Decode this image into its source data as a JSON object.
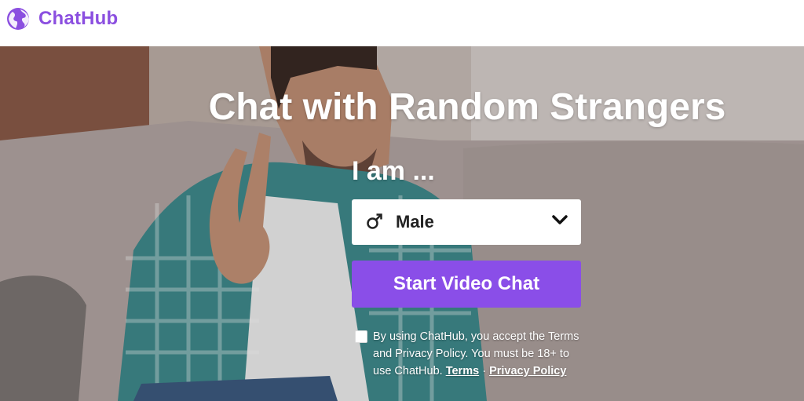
{
  "header": {
    "brand": "ChatHub",
    "logo_icon": "globe-icon",
    "brand_color": "#8b4fe0"
  },
  "hero": {
    "headline": "Chat with Random Strangers",
    "prompt": "I am ...",
    "gender_select": {
      "icon": "male-symbol-icon",
      "selected": "Male"
    },
    "start_button": "Start Video Chat",
    "button_color": "#8a4ee8",
    "consent": {
      "text": "By using ChatHub, you accept the Terms and Privacy Policy. You must be 18+ to use ChatHub.",
      "terms_link": "Terms",
      "separator": "·",
      "privacy_link": "Privacy Policy"
    }
  }
}
